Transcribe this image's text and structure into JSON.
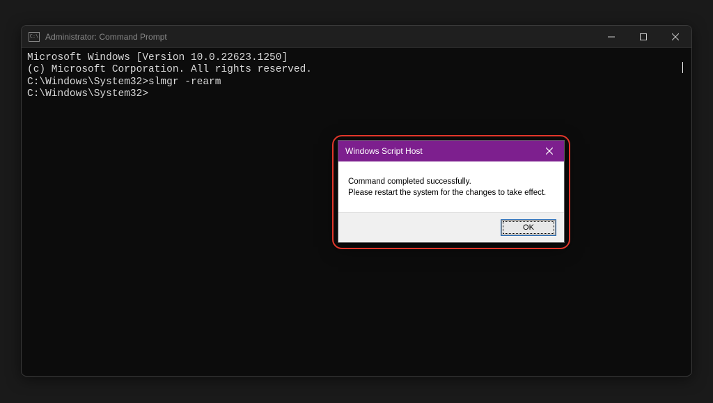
{
  "cmd": {
    "title": "Administrator: Command Prompt",
    "lines": {
      "l0": "Microsoft Windows [Version 10.0.22623.1250]",
      "l1": "(c) Microsoft Corporation. All rights reserved.",
      "l2": "",
      "l3": "C:\\Windows\\System32>slmgr -rearm",
      "l4": "",
      "l5": "C:\\Windows\\System32>"
    },
    "icon_text": "C:\\"
  },
  "dialog": {
    "title": "Windows Script Host",
    "message_line1": "Command completed successfully.",
    "message_line2": "Please restart the system for the changes to take effect.",
    "ok_label": "OK"
  }
}
